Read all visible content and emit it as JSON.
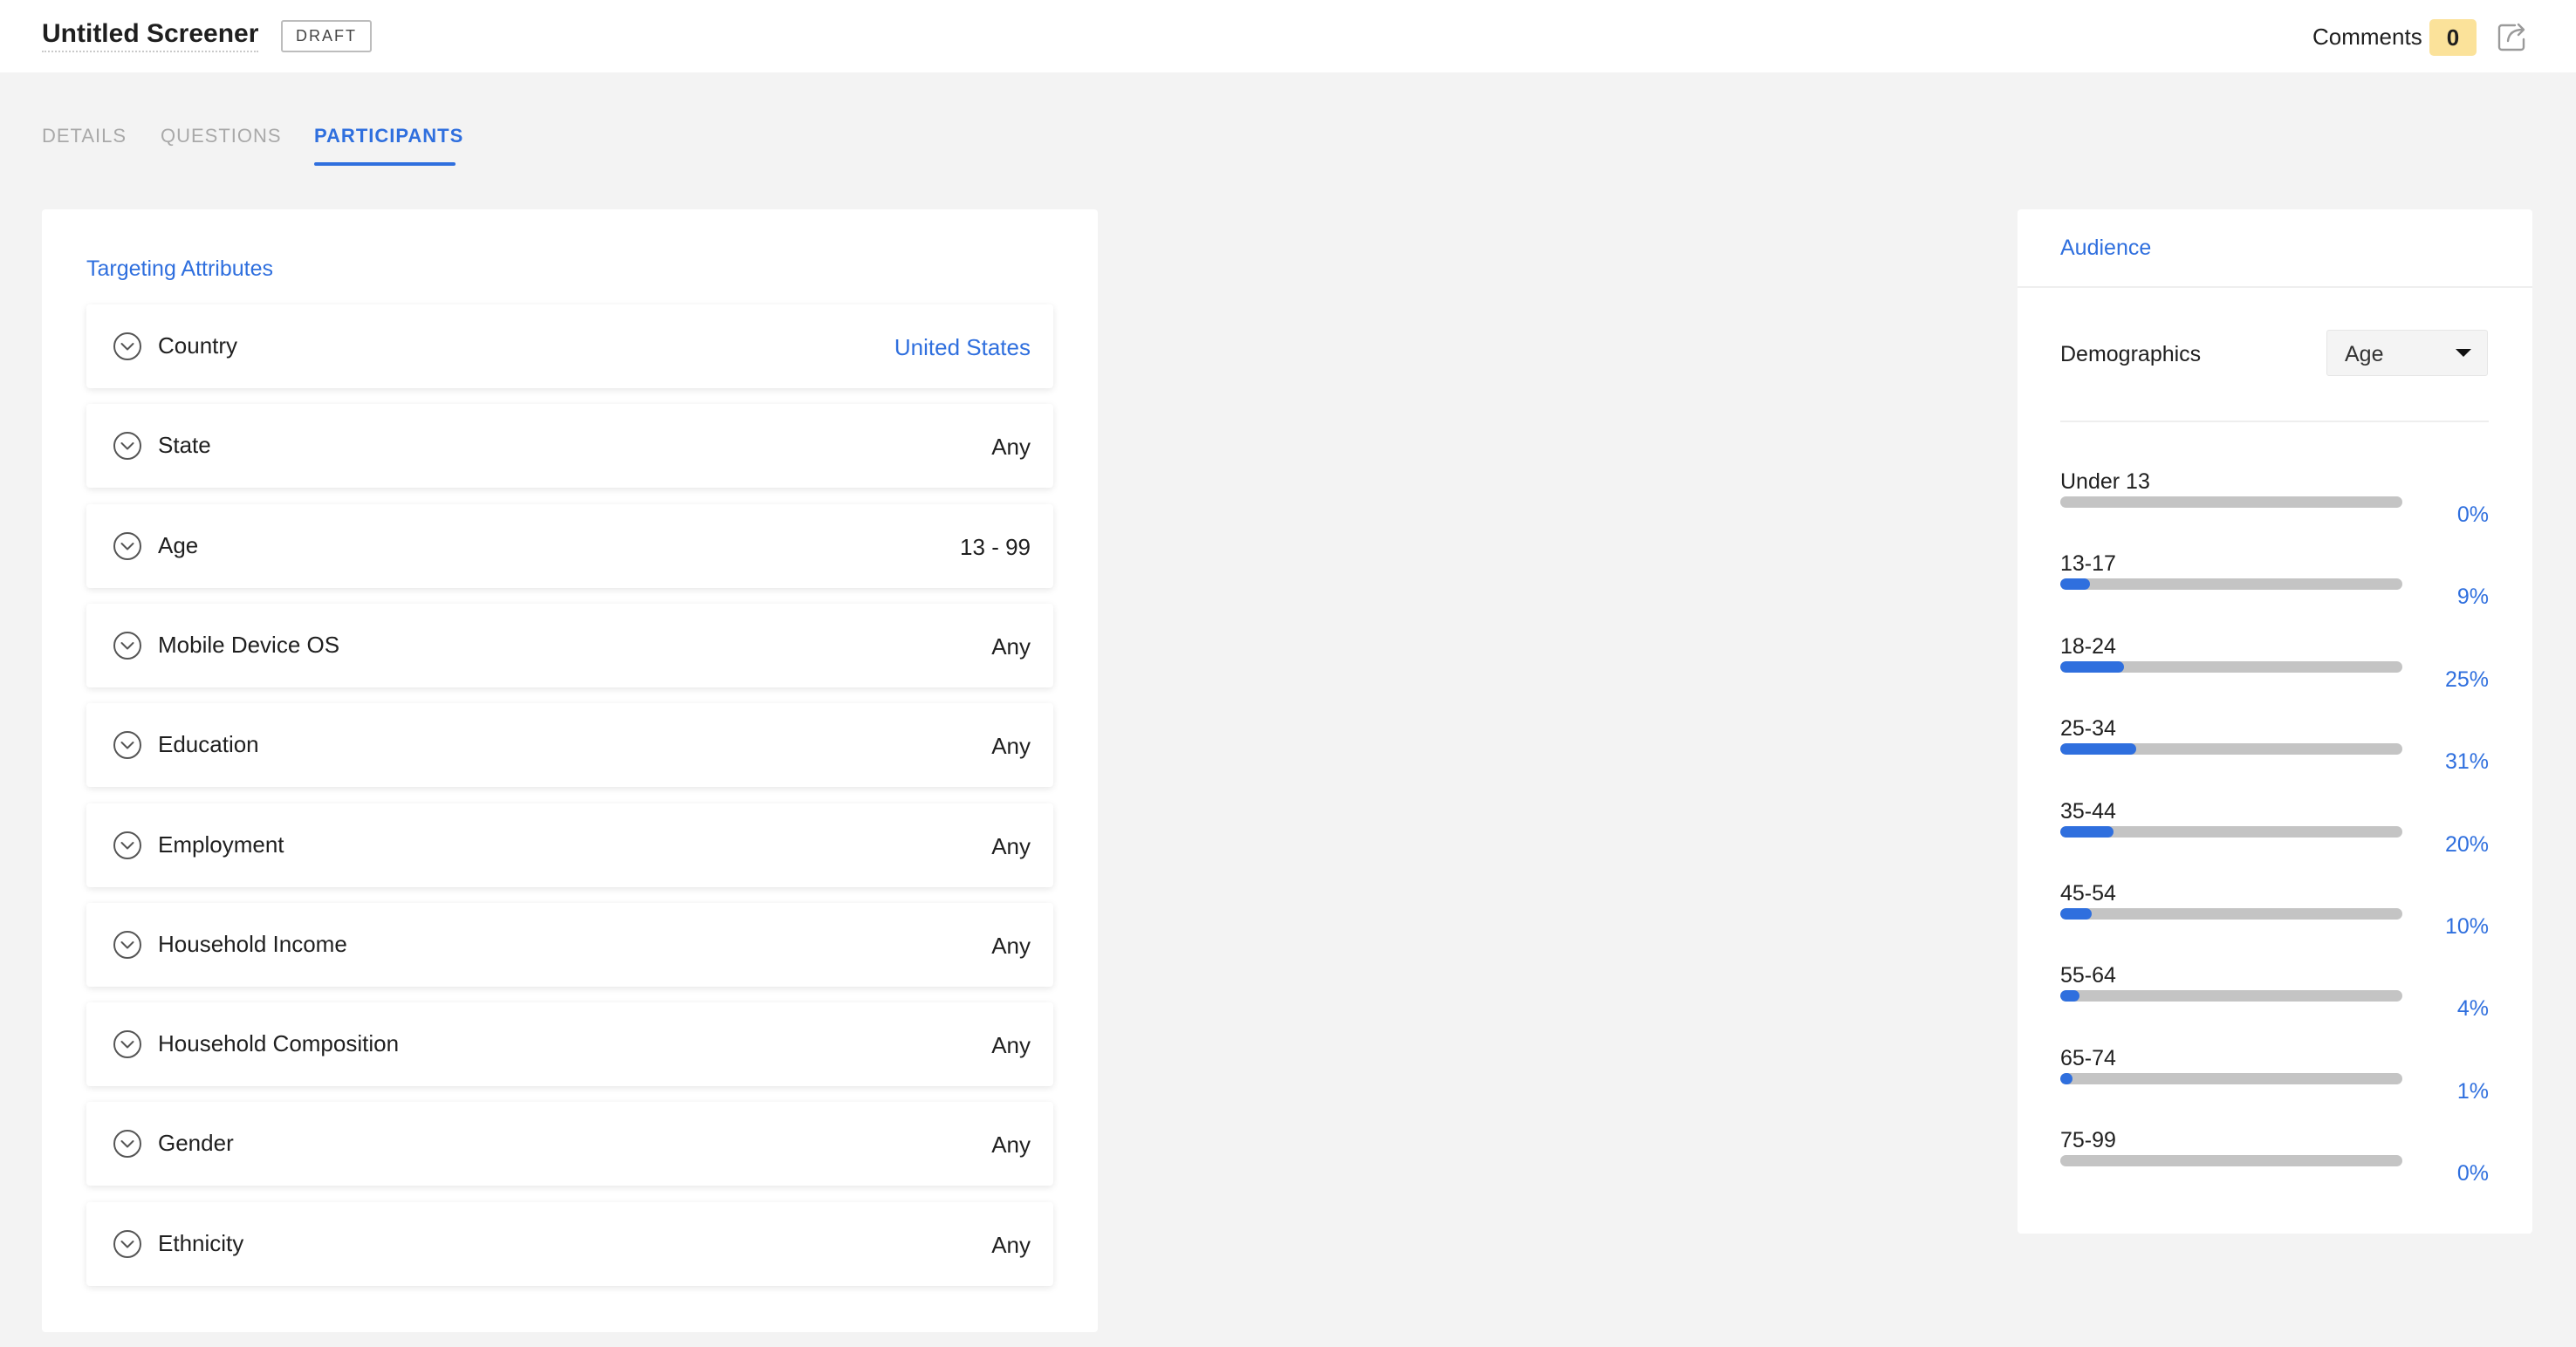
{
  "header": {
    "title": "Untitled Screener",
    "status_badge": "DRAFT",
    "comments_label": "Comments",
    "comments_count": "0"
  },
  "tabs": [
    {
      "label": "DETAILS",
      "active": false
    },
    {
      "label": "QUESTIONS",
      "active": false
    },
    {
      "label": "PARTICIPANTS",
      "active": true
    }
  ],
  "targeting": {
    "title": "Targeting Attributes",
    "attributes": [
      {
        "label": "Country",
        "value": "United States",
        "highlighted": true
      },
      {
        "label": "State",
        "value": "Any",
        "highlighted": false
      },
      {
        "label": "Age",
        "value": "13 - 99",
        "highlighted": false
      },
      {
        "label": "Mobile Device OS",
        "value": "Any",
        "highlighted": false
      },
      {
        "label": "Education",
        "value": "Any",
        "highlighted": false
      },
      {
        "label": "Employment",
        "value": "Any",
        "highlighted": false
      },
      {
        "label": "Household Income",
        "value": "Any",
        "highlighted": false
      },
      {
        "label": "Household Composition",
        "value": "Any",
        "highlighted": false
      },
      {
        "label": "Gender",
        "value": "Any",
        "highlighted": false
      },
      {
        "label": "Ethnicity",
        "value": "Any",
        "highlighted": false
      }
    ]
  },
  "audience": {
    "title": "Audience",
    "demographics_label": "Demographics",
    "demographics_selected": "Age",
    "distribution": [
      {
        "label": "Under 13",
        "percent_text": "0%",
        "fill_fraction": 0.0
      },
      {
        "label": "13-17",
        "percent_text": "9%",
        "fill_fraction": 0.09
      },
      {
        "label": "18-24",
        "percent_text": "25%",
        "fill_fraction": 0.25
      },
      {
        "label": "25-34",
        "percent_text": "31%",
        "fill_fraction": 0.31
      },
      {
        "label": "35-44",
        "percent_text": "20%",
        "fill_fraction": 0.2
      },
      {
        "label": "45-54",
        "percent_text": "10%",
        "fill_fraction": 0.1
      },
      {
        "label": "55-64",
        "percent_text": "4%",
        "fill_fraction": 0.04
      },
      {
        "label": "65-74",
        "percent_text": "1%",
        "fill_fraction": 0.01
      },
      {
        "label": "75-99",
        "percent_text": "0%",
        "fill_fraction": 0.0
      }
    ]
  },
  "colors": {
    "accent": "#2f6fde",
    "badge_highlight": "#fbe29a",
    "bar_track": "#c4c4c4",
    "background": "#f3f3f3"
  },
  "icons": {
    "share": "share-icon",
    "attribute_expand": "chevron-down-circle-icon",
    "dropdown": "caret-down-icon"
  }
}
